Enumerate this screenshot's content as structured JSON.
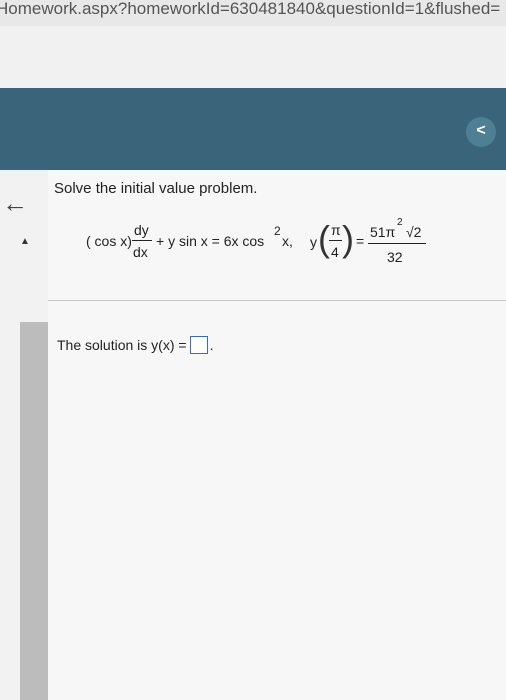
{
  "browser": {
    "url_fragment": "Homework.aspx?homeworkId=630481840&questionId=1&flushed="
  },
  "header": {
    "nav_button_label": "<"
  },
  "nav": {
    "back_arrow": "←",
    "collapse_marker": "▲"
  },
  "question": {
    "prompt": "Solve the initial value problem.",
    "equation": {
      "open_paren": "( cos x)",
      "dy": "dy",
      "dx": "dx",
      "middle": "+ y sin x = 6x cos",
      "exponent": "2",
      "tail": "x,",
      "y_label": "y",
      "pi": "π",
      "four": "4",
      "equals": "=",
      "numerator": "51π",
      "numerator_exp": "2",
      "root": "√2",
      "denominator": "32"
    },
    "answer_prefix": "The solution is y(x) =",
    "answer_suffix": ".",
    "answer_value": ""
  }
}
